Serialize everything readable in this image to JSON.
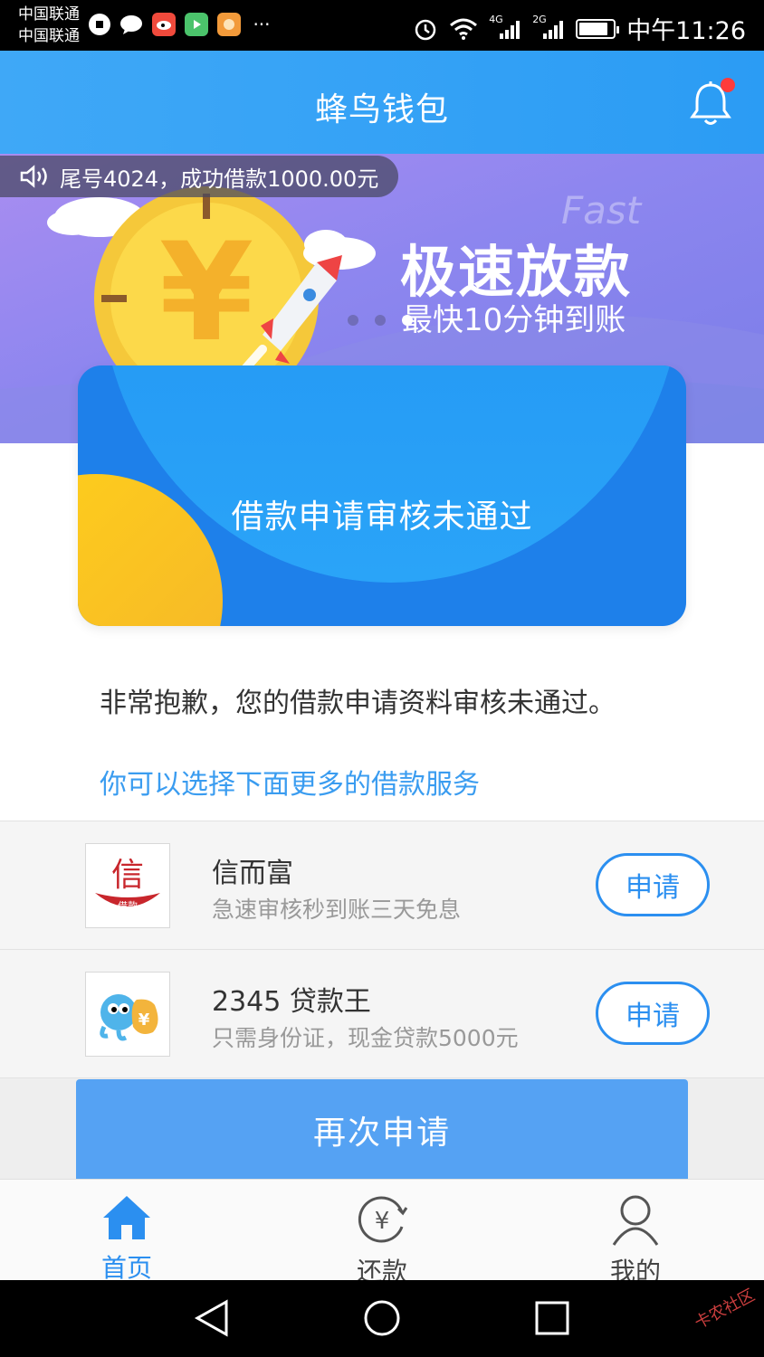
{
  "status_bar": {
    "carrier1": "中国联通",
    "carrier2": "中国联通",
    "network1": "4G",
    "network2": "2G",
    "time": "中午11:26",
    "battery_level": 0.85
  },
  "header": {
    "title": "蜂鸟钱包",
    "bell_icon": "bell-icon",
    "has_notification": true
  },
  "banner": {
    "notice": "尾号4024，成功借款1000.00元",
    "fast_text": "Fast",
    "title": "极速放款",
    "subtitle": "最快10分钟到账",
    "dots_count": 3,
    "active_dot": 2
  },
  "status_card": {
    "text": "借款申请审核未通过"
  },
  "message": "非常抱歉，您的借款申请资料审核未通过。",
  "more_services": "你可以选择下面更多的借款服务",
  "loans": [
    {
      "name": "信而富",
      "desc": "急速审核秒到账三天免息",
      "logo_char": "信",
      "logo_tag": "借款",
      "apply_label": "申请"
    },
    {
      "name": "2345 贷款王",
      "desc": "只需身份证，现金贷款5000元",
      "logo_char": "¥",
      "apply_label": "申请"
    }
  ],
  "reapply_label": "再次申请",
  "tabs": [
    {
      "label": "首页",
      "icon": "home-icon",
      "active": true
    },
    {
      "label": "还款",
      "icon": "repay-icon",
      "active": false
    },
    {
      "label": "我的",
      "icon": "user-icon",
      "active": false
    }
  ],
  "watermark": "卡农社区",
  "colors": {
    "primary": "#2b8ff0",
    "header": "#3fa8f7",
    "card": "#1e80ea",
    "accent_yellow": "#ffd11a"
  }
}
